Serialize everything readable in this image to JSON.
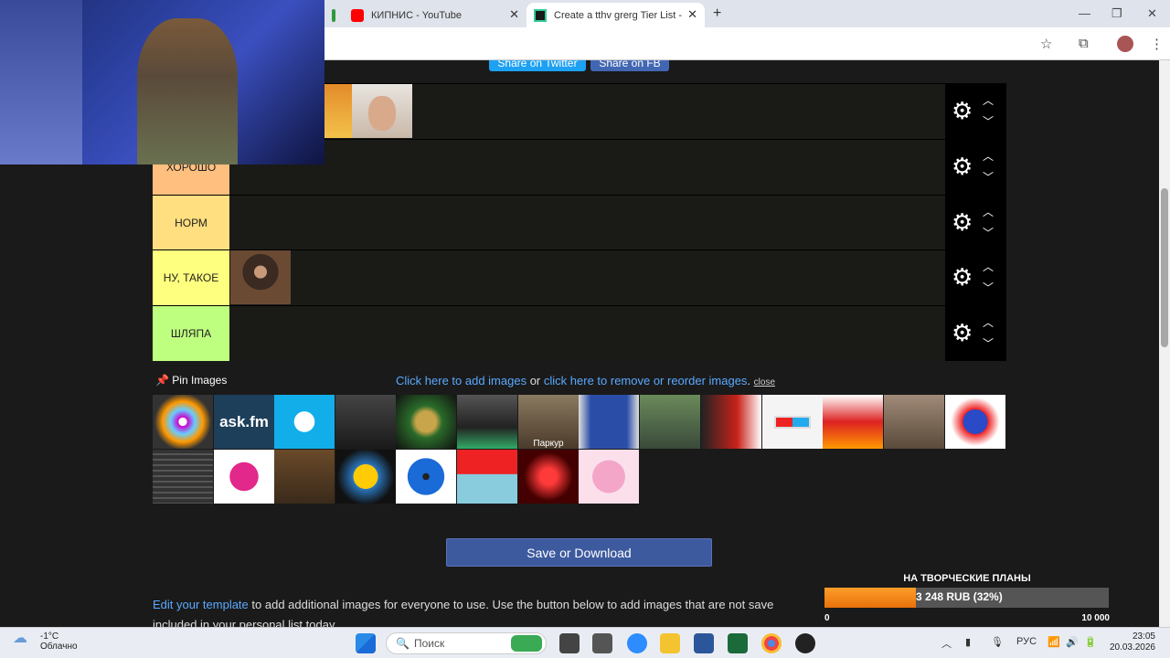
{
  "browser": {
    "tabs": [
      {
        "title": "КИПНИС - YouTube",
        "active": false
      },
      {
        "title": "Create a tthv grerg Tier List - Ti",
        "active": true
      }
    ]
  },
  "share": {
    "twitter": "Share on Twitter",
    "fb": "Share on FB"
  },
  "tiers": [
    {
      "label": "",
      "color": "#ff7f7f"
    },
    {
      "label": "ХОРОШО",
      "color": "#ffbf7f"
    },
    {
      "label": "НОРМ",
      "color": "#ffdf7f"
    },
    {
      "label": "НУ, ТАКОЕ",
      "color": "#ffff7f"
    },
    {
      "label": "ШЛЯПА",
      "color": "#bfff7f"
    }
  ],
  "pin": {
    "label": "Pin Images"
  },
  "links": {
    "add": "Click here to add images",
    "or": "or",
    "remove": "click here to remove or reorder images",
    "close": "close"
  },
  "pool_labels": {
    "cat": "Паркур"
  },
  "save_label": "Save or Download",
  "edit": {
    "link": "Edit your template",
    "text": "to add additional images for everyone to use. Use the button below to add images that are not save",
    "text2": "included in your personal list today"
  },
  "donation": {
    "title": "НА ТВОРЧЕСКИЕ ПЛАНЫ",
    "amount": "3 248 RUB (32%)",
    "progress_percent": 32,
    "min": "0",
    "max": "10 000"
  },
  "taskbar": {
    "temp": "-1°C",
    "weather": "Облачно",
    "search": "Поиск",
    "lang": "РУС",
    "time": "23:05",
    "date": "20.03.2026"
  }
}
